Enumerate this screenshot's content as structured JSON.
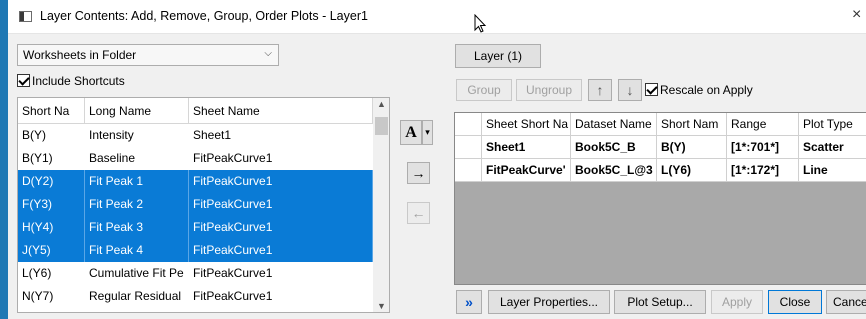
{
  "window": {
    "title": "Layer Contents: Add, Remove, Group, Order Plots - Layer1",
    "close_symbol": "×"
  },
  "left": {
    "source_select": {
      "value": "Worksheets in Folder",
      "arrow": "⌵"
    },
    "include_shortcuts": {
      "label": "Include Shortcuts",
      "checked": true
    },
    "columns": [
      "Short Na",
      "Long Name",
      "Sheet Name"
    ],
    "rows": [
      {
        "short": "B(Y)",
        "long": "Intensity",
        "sheet": "Sheet1",
        "selected": false
      },
      {
        "short": "B(Y1)",
        "long": "Baseline",
        "sheet": "FitPeakCurve1",
        "selected": false
      },
      {
        "short": "D(Y2)",
        "long": "Fit Peak 1",
        "sheet": "FitPeakCurve1",
        "selected": true
      },
      {
        "short": "F(Y3)",
        "long": "Fit Peak 2",
        "sheet": "FitPeakCurve1",
        "selected": true
      },
      {
        "short": "H(Y4)",
        "long": "Fit Peak 3",
        "sheet": "FitPeakCurve1",
        "selected": true
      },
      {
        "short": "J(Y5)",
        "long": "Fit Peak 4",
        "sheet": "FitPeakCurve1",
        "selected": true
      },
      {
        "short": "L(Y6)",
        "long": "Cumulative Fit Pe",
        "sheet": "FitPeakCurve1",
        "selected": false
      },
      {
        "short": "N(Y7)",
        "long": "Regular Residual",
        "sheet": "FitPeakCurve1",
        "selected": false
      }
    ]
  },
  "middle": {
    "plot_type_button": "A",
    "plot_type_dropdown": "▾",
    "add_arrow": "→",
    "remove_arrow": "←"
  },
  "right": {
    "layer_tab": "Layer (1)",
    "group_label": "Group",
    "ungroup_label": "Ungroup",
    "move_up": "↑",
    "move_down": "↓",
    "rescale": {
      "label": "Rescale on Apply",
      "checked": true
    },
    "columns": [
      "Sheet Short Na",
      "Dataset Name",
      "Short Nam",
      "Range",
      "Plot Type"
    ],
    "rows": [
      {
        "sheet": "Sheet1",
        "dataset": "Book5C_B",
        "short": "B(Y)",
        "range": "[1*:701*]",
        "type": "Scatter"
      },
      {
        "sheet": "FitPeakCurve'",
        "dataset": "Book5C_L@3",
        "short": "L(Y6)",
        "range": "[1*:172*]",
        "type": "Line"
      }
    ]
  },
  "footer": {
    "expand": "»",
    "layer_properties": "Layer Properties...",
    "plot_setup": "Plot Setup...",
    "apply": "Apply",
    "close": "Close",
    "cancel": "Cance"
  },
  "colors": {
    "selection": "#0a7bd6",
    "frame": "#1f78b4",
    "focus": "#0078d7"
  }
}
